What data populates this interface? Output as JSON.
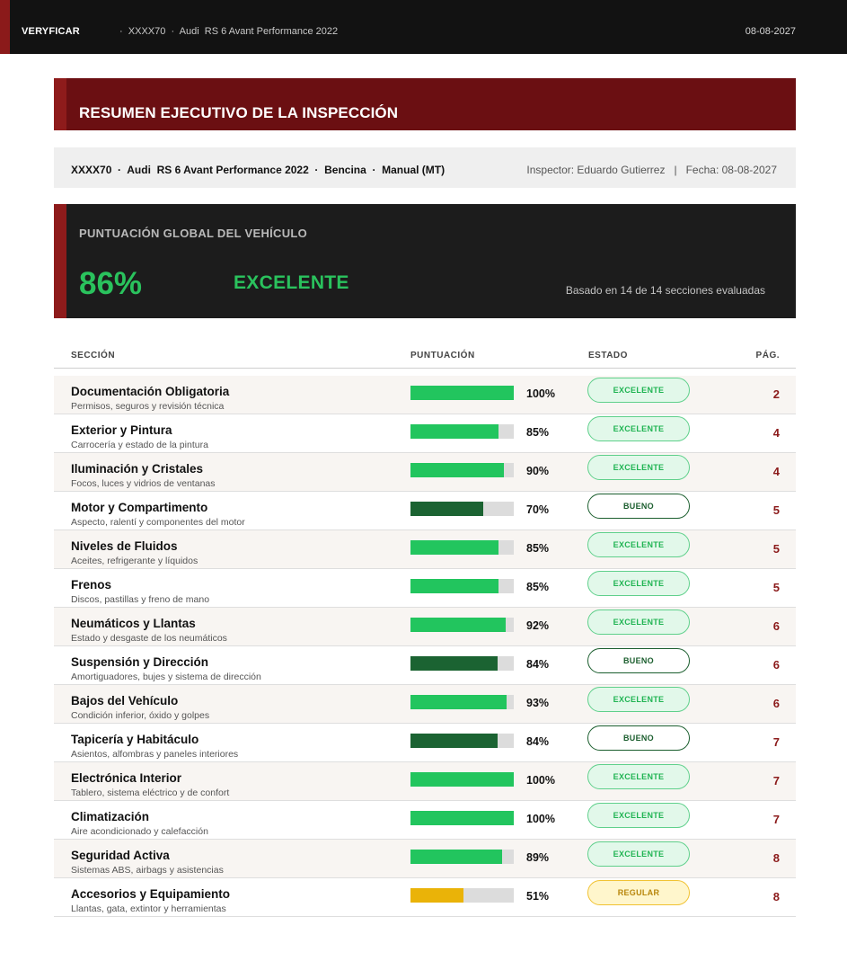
{
  "header": {
    "brand": "VERYFICAR",
    "breadcrumb": "·  XXXX70  ·  Audi  RS 6 Avant Performance 2022",
    "date": "08-08-2027"
  },
  "report_title": "RESUMEN EJECUTIVO DE LA INSPECCIÓN",
  "vehicle_line": "XXXX70  ·  Audi  RS 6 Avant Performance 2022  ·  Bencina  ·  Manual (MT)",
  "inspector_line": "Inspector: Eduardo Gutierrez   |   Fecha: 08-08-2027",
  "score": {
    "label": "PUNTUACIÓN GLOBAL DEL VEHÍCULO",
    "value": "86%",
    "rating": "EXCELENTE",
    "basis": "Basado en 14 de 14 secciones evaluadas"
  },
  "table": {
    "headers": {
      "section": "SECCIÓN",
      "score": "PUNTUACIÓN",
      "status": "ESTADO",
      "page": "PÁG."
    },
    "rows": [
      {
        "name": "Documentación Obligatoria",
        "desc": "Permisos, seguros y revisión técnica",
        "percent": 100,
        "score_label": "100%",
        "status": "EXCELENTE",
        "page": "2"
      },
      {
        "name": "Exterior y Pintura",
        "desc": "Carrocería y estado de la pintura",
        "percent": 85,
        "score_label": "85%",
        "status": "EXCELENTE",
        "page": "4"
      },
      {
        "name": "Iluminación y Cristales",
        "desc": "Focos, luces y vidrios de ventanas",
        "percent": 90,
        "score_label": "90%",
        "status": "EXCELENTE",
        "page": "4"
      },
      {
        "name": "Motor y Compartimento",
        "desc": "Aspecto, ralentí y componentes del motor",
        "percent": 70,
        "score_label": "70%",
        "status": "BUENO",
        "page": "5"
      },
      {
        "name": "Niveles de Fluidos",
        "desc": "Aceites, refrigerante y líquidos",
        "percent": 85,
        "score_label": "85%",
        "status": "EXCELENTE",
        "page": "5"
      },
      {
        "name": "Frenos",
        "desc": "Discos, pastillas y freno de mano",
        "percent": 85,
        "score_label": "85%",
        "status": "EXCELENTE",
        "page": "5"
      },
      {
        "name": "Neumáticos y Llantas",
        "desc": "Estado y desgaste de los neumáticos",
        "percent": 92,
        "score_label": "92%",
        "status": "EXCELENTE",
        "page": "6"
      },
      {
        "name": "Suspensión y Dirección",
        "desc": "Amortiguadores, bujes y sistema de dirección",
        "percent": 84,
        "score_label": "84%",
        "status": "BUENO",
        "page": "6"
      },
      {
        "name": "Bajos del Vehículo",
        "desc": "Condición inferior, óxido y golpes",
        "percent": 93,
        "score_label": "93%",
        "status": "EXCELENTE",
        "page": "6"
      },
      {
        "name": "Tapicería y Habitáculo",
        "desc": "Asientos, alfombras y paneles interiores",
        "percent": 84,
        "score_label": "84%",
        "status": "BUENO",
        "page": "7"
      },
      {
        "name": "Electrónica Interior",
        "desc": "Tablero, sistema eléctrico y de confort",
        "percent": 100,
        "score_label": "100%",
        "status": "EXCELENTE",
        "page": "7"
      },
      {
        "name": "Climatización",
        "desc": "Aire acondicionado y calefacción",
        "percent": 100,
        "score_label": "100%",
        "status": "EXCELENTE",
        "page": "7"
      },
      {
        "name": "Seguridad Activa",
        "desc": "Sistemas ABS, airbags y asistencias",
        "percent": 89,
        "score_label": "89%",
        "status": "EXCELENTE",
        "page": "8"
      },
      {
        "name": "Accesorios y Equipamiento",
        "desc": "Llantas, gata, extintor y herramientas",
        "percent": 51,
        "score_label": "51%",
        "status": "REGULAR",
        "page": "8"
      }
    ]
  },
  "colors": {
    "excelente": "#22c55e",
    "bueno": "#1b6332",
    "regular": "#eab308",
    "brand_red": "#6b0f12"
  }
}
